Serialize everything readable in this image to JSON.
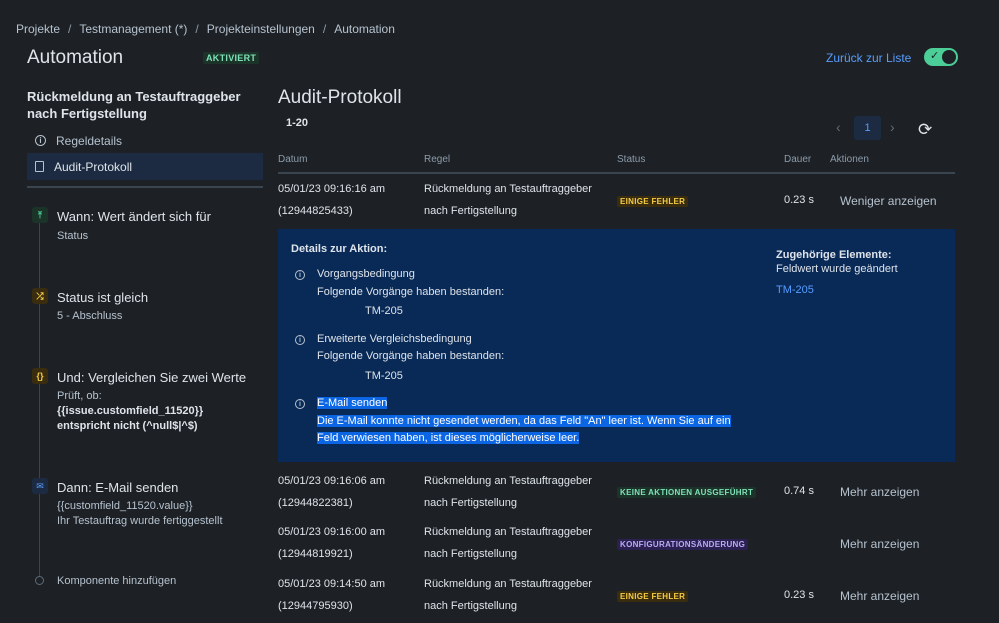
{
  "breadcrumb": [
    "Projekte",
    "Testmanagement (*)",
    "Projekteinstellungen",
    "Automation"
  ],
  "page_title": "Automation",
  "status": "AKTIVIERT",
  "back_link": "Zurück zur Liste",
  "toggle_on": true,
  "rule_name": "Rückmeldung an Testauftraggeber nach Fertigstellung",
  "sidebar": {
    "items": [
      {
        "label": "Regeldetails",
        "icon": "info-icon"
      },
      {
        "label": "Audit-Protokoll",
        "icon": "document-icon"
      }
    ]
  },
  "components": [
    {
      "title": "Wann: Wert ändert sich für",
      "sub1": "Status",
      "sub2": "",
      "sub3": "",
      "icon": "trigger-icon",
      "color": "#4bce97"
    },
    {
      "title": "Status ist gleich",
      "sub1": "5 - Abschluss",
      "sub2": "",
      "sub3": "",
      "icon": "shuffle-icon",
      "color": "#f5cd47"
    },
    {
      "title": "Und: Vergleichen Sie zwei Werte",
      "sub1": "Prüft, ob:",
      "sub2": "{{issue.customfield_11520}}",
      "sub3": "entspricht nicht (^null$|^$)",
      "icon": "braces-icon",
      "color": "#f5cd47"
    },
    {
      "title": "Dann: E-Mail senden",
      "sub1": "{{customfield_11520.value}}",
      "sub2": "Ihr Testauftrag wurde fertiggestellt",
      "sub3": "",
      "icon": "mail-icon",
      "color": "#579dff"
    }
  ],
  "add_component": "Komponente hinzufügen",
  "audit": {
    "title": "Audit-Protokoll",
    "range": "1-20",
    "page": "1",
    "columns": [
      "Datum",
      "Regel",
      "Status",
      "Dauer",
      "Aktionen"
    ],
    "rows": [
      {
        "date": "05/01/23 09:16:16 am",
        "id": "(12944825433)",
        "rule1": "Rückmeldung an Testauftraggeber",
        "rule2": "nach Fertigstellung",
        "status": "EINIGE FEHLER",
        "kind": "warn",
        "duration": "0.23 s",
        "action": "Weniger anzeigen"
      },
      {
        "date": "05/01/23 09:16:06 am",
        "id": "(12944822381)",
        "rule1": "Rückmeldung an Testauftraggeber",
        "rule2": "nach Fertigstellung",
        "status": "KEINE AKTIONEN AUSGEFÜHRT",
        "kind": "ok",
        "duration": "0.74 s",
        "action": "Mehr anzeigen"
      },
      {
        "date": "05/01/23 09:16:00 am",
        "id": "(12944819921)",
        "rule1": "Rückmeldung an Testauftraggeber",
        "rule2": "nach Fertigstellung",
        "status": "KONFIGURATIONSÄNDERUNG",
        "kind": "info",
        "duration": "",
        "action": "Mehr anzeigen"
      },
      {
        "date": "05/01/23 09:14:50 am",
        "id": "(12944795930)",
        "rule1": "Rückmeldung an Testauftraggeber",
        "rule2": "nach Fertigstellung",
        "status": "EINIGE FEHLER",
        "kind": "warn",
        "duration": "0.23 s",
        "action": "Mehr anzeigen"
      }
    ]
  },
  "details": {
    "title": "Details zur Aktion:",
    "blocks": [
      {
        "heading": "Vorgangsbedingung",
        "line": "Folgende Vorgänge haben bestanden:",
        "item": "TM-205"
      },
      {
        "heading": "Erweiterte Vergleichsbedingung",
        "line": "Folgende Vorgänge haben bestanden:",
        "item": "TM-205"
      }
    ],
    "email": {
      "heading": "E-Mail senden",
      "line1": "Die E-Mail konnte nicht gesendet werden, da das Feld \"An\" leer ist. Wenn Sie auf ein",
      "line2": "Feld verwiesen haben, ist dieses möglicherweise leer."
    },
    "related_title": "Zugehörige Elemente:",
    "related_sub": "Feldwert wurde geändert",
    "related_link": "TM-205"
  }
}
